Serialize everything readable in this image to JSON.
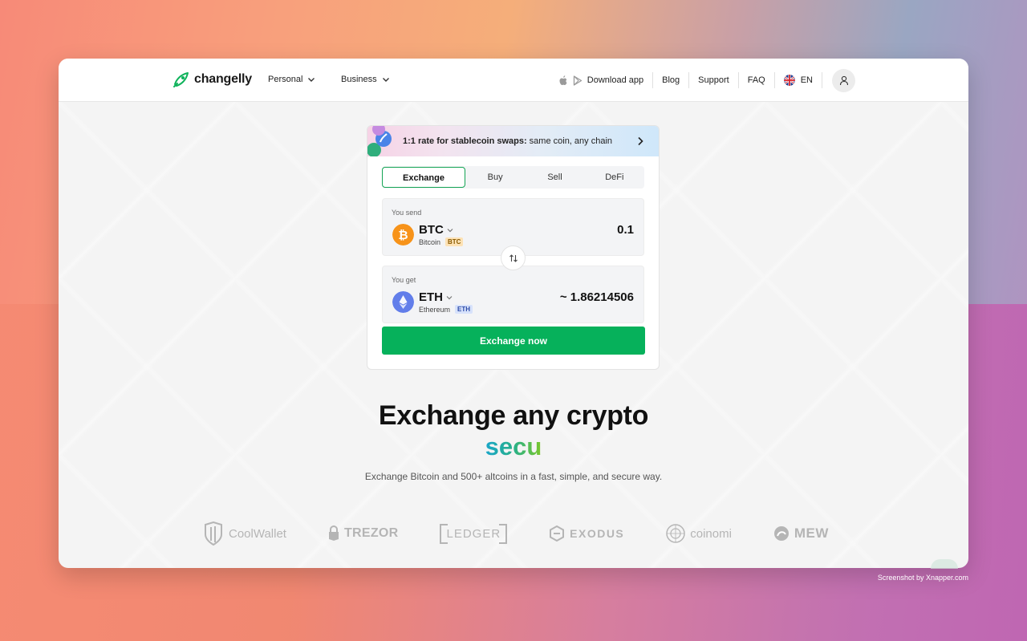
{
  "header": {
    "logo_text": "changelly",
    "nav": [
      {
        "label": "Personal"
      },
      {
        "label": "Business"
      }
    ],
    "download_label": "Download app",
    "blog_label": "Blog",
    "support_label": "Support",
    "faq_label": "FAQ",
    "language_label": "EN"
  },
  "promo": {
    "bold": "1:1 rate for stablecoin swaps:",
    "text": "same coin, any chain"
  },
  "tabs": [
    {
      "label": "Exchange",
      "active": true
    },
    {
      "label": "Buy"
    },
    {
      "label": "Sell"
    },
    {
      "label": "DeFi"
    }
  ],
  "send": {
    "label": "You send",
    "ticker": "BTC",
    "name": "Bitcoin",
    "badge": "BTC",
    "amount": "0.1"
  },
  "get": {
    "label": "You get",
    "ticker": "ETH",
    "name": "Ethereum",
    "badge": "ETH",
    "amount": "~ 1.86214506"
  },
  "exchange_button": "Exchange now",
  "hero": {
    "title": "Exchange any crypto",
    "animated_word": "secu",
    "subtitle": "Exchange Bitcoin and 500+ altcoins in a fast, simple, and secure way."
  },
  "partners": [
    "CoolWallet",
    "TREZOR",
    "LEDGER",
    "EXODUS",
    "coinomi",
    "MEW"
  ],
  "credit": "Screenshot by Xnapper.com",
  "colors": {
    "accent_green": "#06b15b",
    "btc_orange": "#f7931a",
    "eth_blue": "#627eea"
  }
}
